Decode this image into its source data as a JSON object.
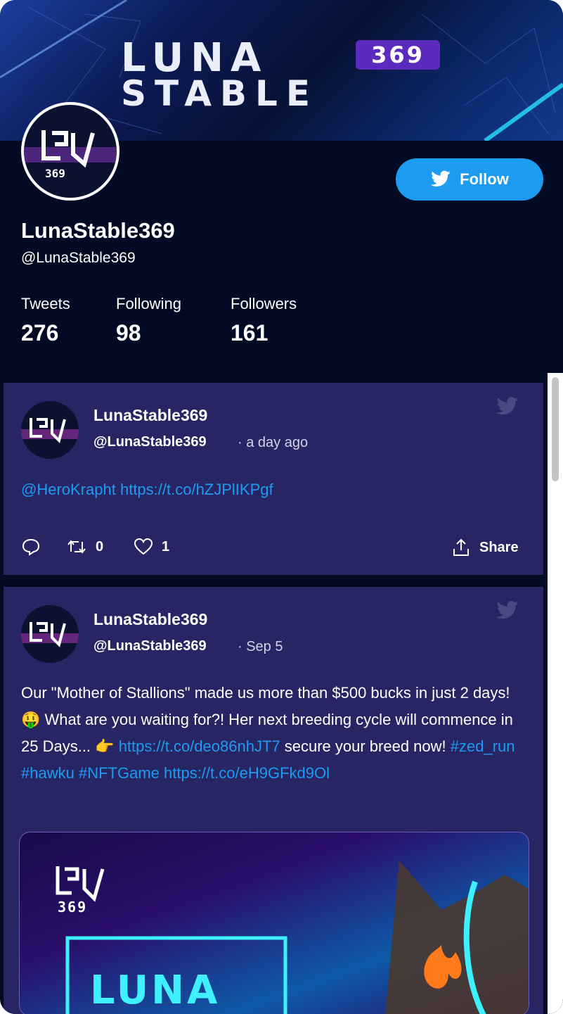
{
  "banner": {
    "word_line1": "LUNA",
    "word_line2": "STABLE",
    "badge": "369"
  },
  "profile": {
    "logo_number": "369",
    "follow_label": "Follow",
    "display_name": "LunaStable369",
    "handle": "@LunaStable369",
    "stats": [
      {
        "label": "Tweets",
        "value": "276"
      },
      {
        "label": "Following",
        "value": "98"
      },
      {
        "label": "Followers",
        "value": "161"
      }
    ]
  },
  "tweets": [
    {
      "name": "LunaStable369",
      "handle": "@LunaStable369",
      "time": "· a day ago",
      "body": {
        "mention": "@HeroKrapht",
        "link": "https://t.co/hZJPlIKPgf"
      },
      "retweets": "0",
      "likes": "1",
      "share_label": "Share"
    },
    {
      "name": "LunaStable369",
      "handle": "@LunaStable369",
      "time": "· Sep 5",
      "body": {
        "text1": "Our \"Mother of Stallions\" made us more than $500 bucks in just 2 days! 🤑 What are you waiting for?! Her next breeding cycle will commence in 25 Days... 👉",
        "link1": "https://t.co/deo86nhJT7",
        "text2": " secure your breed now! ",
        "hashtag1": "#zed_run",
        "hashtag2": "#hawku",
        "hashtag3": "#NFTGame",
        "link2": "https://t.co/eH9GFkd9Ol"
      },
      "media": {
        "logo_number": "369",
        "word": "LUNA"
      }
    }
  ],
  "colors": {
    "background": "#020a24",
    "tweet_card": "#272563",
    "accent": "#1d9bf0"
  }
}
